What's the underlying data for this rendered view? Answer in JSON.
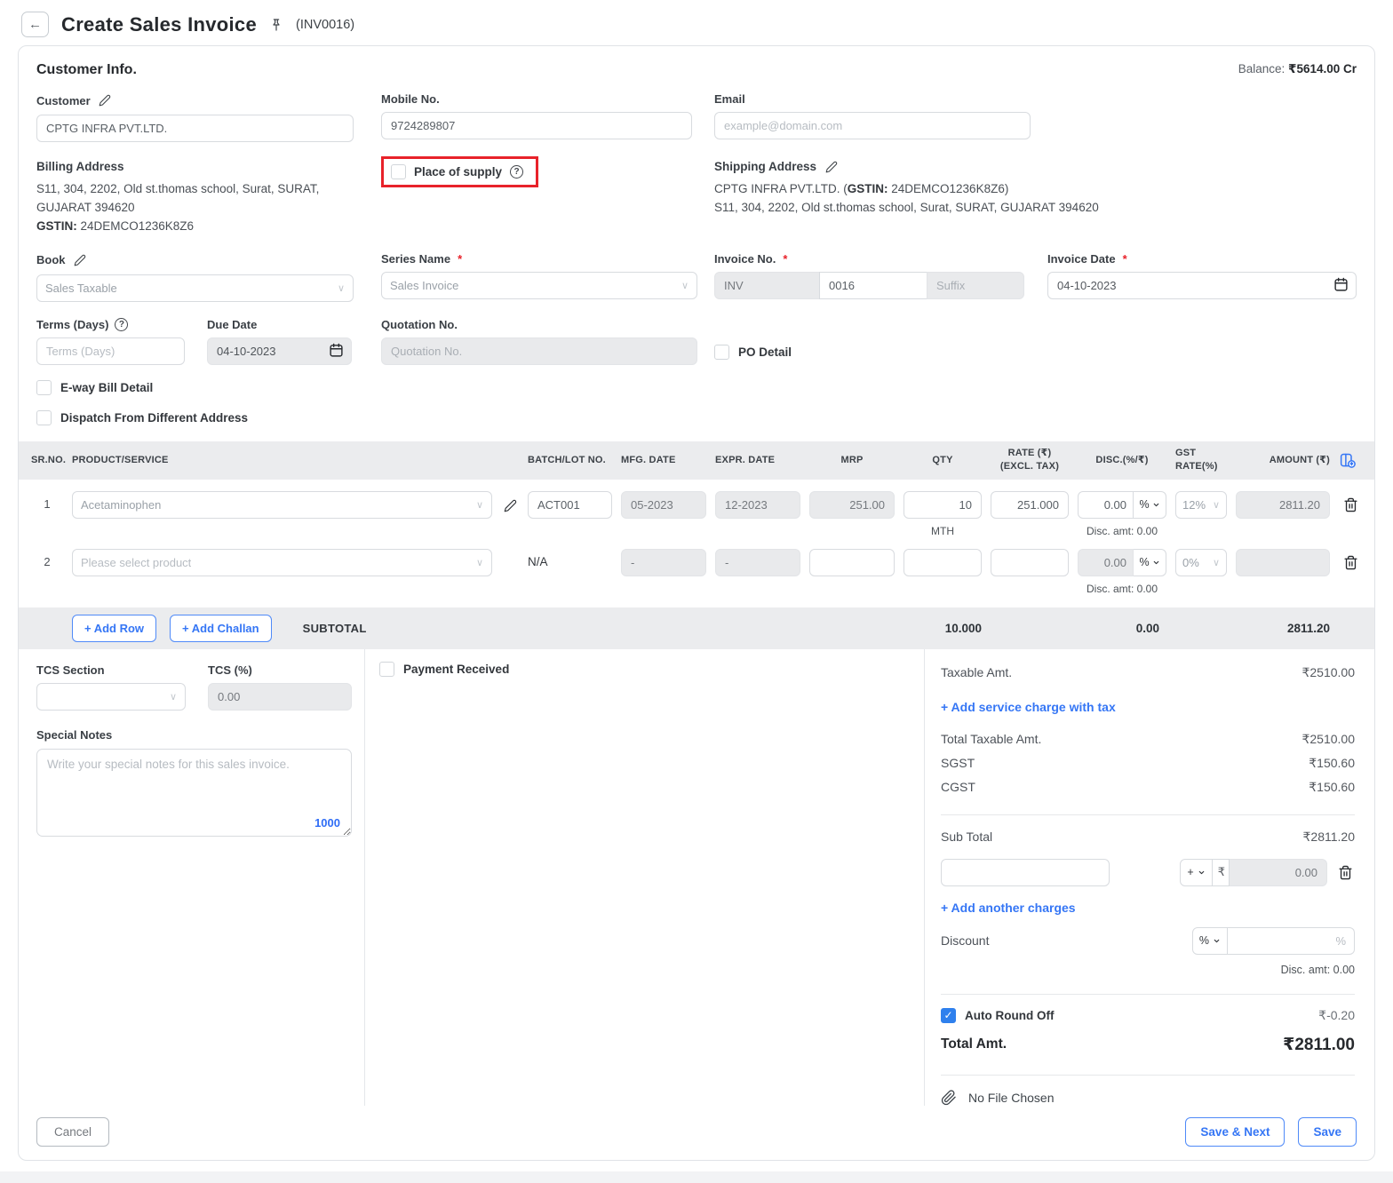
{
  "icons": {
    "back_glyph": "←",
    "help_glyph": "?",
    "check_glyph": "✓",
    "chevron_glyph": "∨"
  },
  "header": {
    "title": "Create Sales Invoice",
    "invoice_ref": "(INV0016)"
  },
  "customer_info": {
    "section_title": "Customer Info.",
    "balance_label": "Balance:",
    "balance_value": "₹5614.00 Cr",
    "customer_label": "Customer",
    "customer_value": "CPTG INFRA PVT.LTD.",
    "mobile_label": "Mobile No.",
    "mobile_value": "9724289807",
    "email_label": "Email",
    "email_placeholder": "example@domain.com",
    "billing_label": "Billing Address",
    "billing_line1": "S11, 304, 2202, Old st.thomas school, Surat, SURAT,",
    "billing_line2": "GUJARAT 394620",
    "billing_gstin_label": "GSTIN:",
    "billing_gstin_value": " 24DEMCO1236K8Z6",
    "place_of_supply_label": "Place of supply",
    "shipping_label": "Shipping Address",
    "shipping_name": "CPTG INFRA PVT.LTD. (",
    "shipping_gstin_label": "GSTIN:",
    "shipping_gstin_value": " 24DEMCO1236K8Z6)",
    "shipping_line2": "S11, 304, 2202, Old st.thomas school, Surat, SURAT, GUJARAT 394620"
  },
  "form": {
    "book_label": "Book",
    "book_value": "Sales Taxable",
    "series_label": "Series Name",
    "series_value": "Sales Invoice",
    "invoice_no_label": "Invoice No.",
    "invoice_prefix": "INV",
    "invoice_number": "0016",
    "invoice_suffix_placeholder": "Suffix",
    "invoice_date_label": "Invoice Date",
    "invoice_date_value": "04-10-2023",
    "terms_label": "Terms (Days)",
    "terms_placeholder": "Terms (Days)",
    "due_date_label": "Due Date",
    "due_date_value": "04-10-2023",
    "quotation_label": "Quotation No.",
    "quotation_placeholder": "Quotation No.",
    "po_detail_label": "PO Detail",
    "eway_label": "E-way Bill Detail",
    "dispatch_label": "Dispatch From Different Address",
    "required_mark": "*"
  },
  "table": {
    "headers": {
      "sr": "SR.NO.",
      "product": "PRODUCT/SERVICE",
      "batch": "BATCH/LOT NO.",
      "mfg": "MFG. DATE",
      "expr": "EXPR. DATE",
      "mrp": "MRP",
      "qty": "QTY",
      "rate1": "RATE (₹)",
      "rate2": "(EXCL. TAX)",
      "disc": "DISC.(%/₹)",
      "gst": "GST RATE(%)",
      "amount": "AMOUNT (₹)"
    },
    "rows": [
      {
        "sr": "1",
        "product": "Acetaminophen",
        "batch": "ACT001",
        "mfg": "05-2023",
        "expr": "12-2023",
        "mrp": "251.00",
        "qty": "10",
        "unit": "MTH",
        "rate": "251.000",
        "disc": "0.00",
        "disc_unit": "%",
        "disc_amt": "Disc. amt: 0.00",
        "gst": "12%",
        "amount": "2811.20"
      },
      {
        "sr": "2",
        "product_placeholder": "Please select product",
        "batch_na": "N/A",
        "mfg": "-",
        "expr": "-",
        "disc": "0.00",
        "disc_unit": "%",
        "disc_amt": "Disc. amt: 0.00",
        "gst": "0%"
      }
    ],
    "add_row_label": "+ Add Row",
    "add_challan_label": "+ Add Challan",
    "subtotal_label": "SUBTOTAL",
    "subtotal_qty": "10.000",
    "subtotal_disc": "0.00",
    "subtotal_amount": "2811.20"
  },
  "bottom": {
    "tcs_section_label": "TCS Section",
    "tcs_pct_label": "TCS (%)",
    "tcs_pct_value": "0.00",
    "special_notes_label": "Special Notes",
    "special_notes_placeholder": "Write your special notes for this sales invoice.",
    "notes_counter": "1000",
    "payment_received_label": "Payment Received"
  },
  "totals": {
    "taxable_label": "Taxable Amt.",
    "taxable_value": "₹2510.00",
    "add_service_charge_label": "+ Add service charge with tax",
    "total_taxable_label": "Total Taxable Amt.",
    "total_taxable_value": "₹2510.00",
    "sgst_label": "SGST",
    "sgst_value": "₹150.60",
    "cgst_label": "CGST",
    "cgst_value": "₹150.60",
    "sub_total_label": "Sub Total",
    "sub_total_value": "₹2811.20",
    "charge_sign": "+",
    "charge_currency": "₹",
    "charge_amount": "0.00",
    "add_another_charges_label": "+ Add another charges",
    "discount_label": "Discount",
    "discount_unit": "%",
    "discount_suffix": "%",
    "disc_amt_text": "Disc. amt: 0.00",
    "auto_round_label": "Auto Round Off",
    "auto_round_value": "₹-0.20",
    "total_amt_label": "Total Amt.",
    "total_amt_value": "₹2811.00",
    "no_file_label": "No File Chosen"
  },
  "footer": {
    "cancel_label": "Cancel",
    "save_next_label": "Save & Next",
    "save_label": "Save"
  },
  "colors": {
    "accent_blue": "#3576f5",
    "highlight_red": "#e8222a",
    "checked_blue": "#2f80ed",
    "disabled_bg": "#e9eaec",
    "table_header_bg": "#ebecee"
  }
}
